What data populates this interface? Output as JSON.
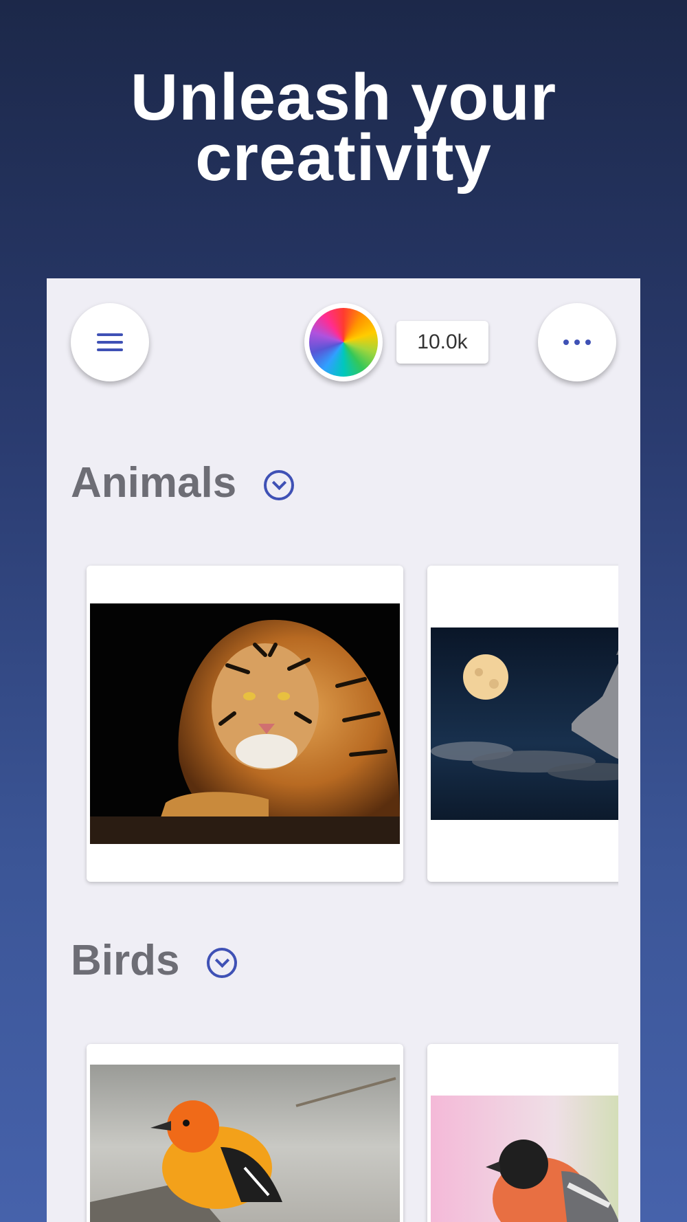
{
  "headline": {
    "line1": "Unleash your",
    "line2": "creativity"
  },
  "toolbar": {
    "menu_icon": "hamburger-menu-icon",
    "color_icon": "color-wheel-icon",
    "count": "10.0k",
    "more_icon": "more-dots-icon"
  },
  "sections": [
    {
      "title": "Animals",
      "chevron_icon": "chevron-down-circle-icon",
      "images": [
        "tiger",
        "wolf-howling-at-moon"
      ]
    },
    {
      "title": "Birds",
      "chevron_icon": "chevron-down-circle-icon",
      "images": [
        "oriole-bird",
        "bullfinch-bird"
      ]
    }
  ],
  "colors": {
    "accent": "#3f51b5",
    "panel": "#efeef5",
    "title_gray": "#6d6d75"
  }
}
